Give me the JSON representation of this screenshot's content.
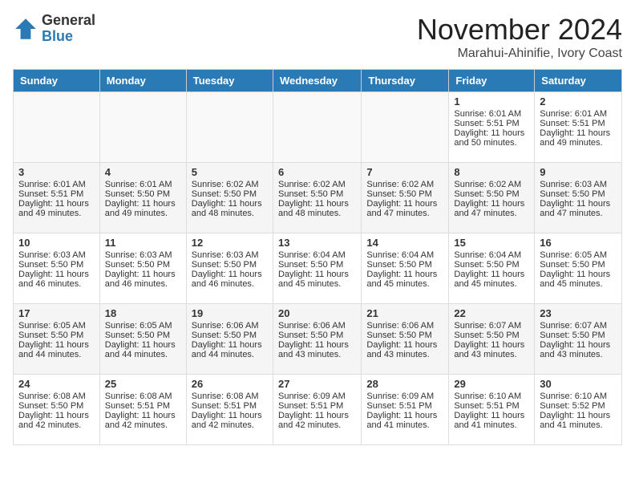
{
  "header": {
    "logo_general": "General",
    "logo_blue": "Blue",
    "month_title": "November 2024",
    "location": "Marahui-Ahinifie, Ivory Coast"
  },
  "calendar": {
    "days_of_week": [
      "Sunday",
      "Monday",
      "Tuesday",
      "Wednesday",
      "Thursday",
      "Friday",
      "Saturday"
    ],
    "weeks": [
      [
        {
          "day": "",
          "sunrise": "",
          "sunset": "",
          "daylight": ""
        },
        {
          "day": "",
          "sunrise": "",
          "sunset": "",
          "daylight": ""
        },
        {
          "day": "",
          "sunrise": "",
          "sunset": "",
          "daylight": ""
        },
        {
          "day": "",
          "sunrise": "",
          "sunset": "",
          "daylight": ""
        },
        {
          "day": "",
          "sunrise": "",
          "sunset": "",
          "daylight": ""
        },
        {
          "day": "1",
          "sunrise": "Sunrise: 6:01 AM",
          "sunset": "Sunset: 5:51 PM",
          "daylight": "Daylight: 11 hours and 50 minutes."
        },
        {
          "day": "2",
          "sunrise": "Sunrise: 6:01 AM",
          "sunset": "Sunset: 5:51 PM",
          "daylight": "Daylight: 11 hours and 49 minutes."
        }
      ],
      [
        {
          "day": "3",
          "sunrise": "Sunrise: 6:01 AM",
          "sunset": "Sunset: 5:51 PM",
          "daylight": "Daylight: 11 hours and 49 minutes."
        },
        {
          "day": "4",
          "sunrise": "Sunrise: 6:01 AM",
          "sunset": "Sunset: 5:50 PM",
          "daylight": "Daylight: 11 hours and 49 minutes."
        },
        {
          "day": "5",
          "sunrise": "Sunrise: 6:02 AM",
          "sunset": "Sunset: 5:50 PM",
          "daylight": "Daylight: 11 hours and 48 minutes."
        },
        {
          "day": "6",
          "sunrise": "Sunrise: 6:02 AM",
          "sunset": "Sunset: 5:50 PM",
          "daylight": "Daylight: 11 hours and 48 minutes."
        },
        {
          "day": "7",
          "sunrise": "Sunrise: 6:02 AM",
          "sunset": "Sunset: 5:50 PM",
          "daylight": "Daylight: 11 hours and 47 minutes."
        },
        {
          "day": "8",
          "sunrise": "Sunrise: 6:02 AM",
          "sunset": "Sunset: 5:50 PM",
          "daylight": "Daylight: 11 hours and 47 minutes."
        },
        {
          "day": "9",
          "sunrise": "Sunrise: 6:03 AM",
          "sunset": "Sunset: 5:50 PM",
          "daylight": "Daylight: 11 hours and 47 minutes."
        }
      ],
      [
        {
          "day": "10",
          "sunrise": "Sunrise: 6:03 AM",
          "sunset": "Sunset: 5:50 PM",
          "daylight": "Daylight: 11 hours and 46 minutes."
        },
        {
          "day": "11",
          "sunrise": "Sunrise: 6:03 AM",
          "sunset": "Sunset: 5:50 PM",
          "daylight": "Daylight: 11 hours and 46 minutes."
        },
        {
          "day": "12",
          "sunrise": "Sunrise: 6:03 AM",
          "sunset": "Sunset: 5:50 PM",
          "daylight": "Daylight: 11 hours and 46 minutes."
        },
        {
          "day": "13",
          "sunrise": "Sunrise: 6:04 AM",
          "sunset": "Sunset: 5:50 PM",
          "daylight": "Daylight: 11 hours and 45 minutes."
        },
        {
          "day": "14",
          "sunrise": "Sunrise: 6:04 AM",
          "sunset": "Sunset: 5:50 PM",
          "daylight": "Daylight: 11 hours and 45 minutes."
        },
        {
          "day": "15",
          "sunrise": "Sunrise: 6:04 AM",
          "sunset": "Sunset: 5:50 PM",
          "daylight": "Daylight: 11 hours and 45 minutes."
        },
        {
          "day": "16",
          "sunrise": "Sunrise: 6:05 AM",
          "sunset": "Sunset: 5:50 PM",
          "daylight": "Daylight: 11 hours and 45 minutes."
        }
      ],
      [
        {
          "day": "17",
          "sunrise": "Sunrise: 6:05 AM",
          "sunset": "Sunset: 5:50 PM",
          "daylight": "Daylight: 11 hours and 44 minutes."
        },
        {
          "day": "18",
          "sunrise": "Sunrise: 6:05 AM",
          "sunset": "Sunset: 5:50 PM",
          "daylight": "Daylight: 11 hours and 44 minutes."
        },
        {
          "day": "19",
          "sunrise": "Sunrise: 6:06 AM",
          "sunset": "Sunset: 5:50 PM",
          "daylight": "Daylight: 11 hours and 44 minutes."
        },
        {
          "day": "20",
          "sunrise": "Sunrise: 6:06 AM",
          "sunset": "Sunset: 5:50 PM",
          "daylight": "Daylight: 11 hours and 43 minutes."
        },
        {
          "day": "21",
          "sunrise": "Sunrise: 6:06 AM",
          "sunset": "Sunset: 5:50 PM",
          "daylight": "Daylight: 11 hours and 43 minutes."
        },
        {
          "day": "22",
          "sunrise": "Sunrise: 6:07 AM",
          "sunset": "Sunset: 5:50 PM",
          "daylight": "Daylight: 11 hours and 43 minutes."
        },
        {
          "day": "23",
          "sunrise": "Sunrise: 6:07 AM",
          "sunset": "Sunset: 5:50 PM",
          "daylight": "Daylight: 11 hours and 43 minutes."
        }
      ],
      [
        {
          "day": "24",
          "sunrise": "Sunrise: 6:08 AM",
          "sunset": "Sunset: 5:50 PM",
          "daylight": "Daylight: 11 hours and 42 minutes."
        },
        {
          "day": "25",
          "sunrise": "Sunrise: 6:08 AM",
          "sunset": "Sunset: 5:51 PM",
          "daylight": "Daylight: 11 hours and 42 minutes."
        },
        {
          "day": "26",
          "sunrise": "Sunrise: 6:08 AM",
          "sunset": "Sunset: 5:51 PM",
          "daylight": "Daylight: 11 hours and 42 minutes."
        },
        {
          "day": "27",
          "sunrise": "Sunrise: 6:09 AM",
          "sunset": "Sunset: 5:51 PM",
          "daylight": "Daylight: 11 hours and 42 minutes."
        },
        {
          "day": "28",
          "sunrise": "Sunrise: 6:09 AM",
          "sunset": "Sunset: 5:51 PM",
          "daylight": "Daylight: 11 hours and 41 minutes."
        },
        {
          "day": "29",
          "sunrise": "Sunrise: 6:10 AM",
          "sunset": "Sunset: 5:51 PM",
          "daylight": "Daylight: 11 hours and 41 minutes."
        },
        {
          "day": "30",
          "sunrise": "Sunrise: 6:10 AM",
          "sunset": "Sunset: 5:52 PM",
          "daylight": "Daylight: 11 hours and 41 minutes."
        }
      ]
    ]
  }
}
